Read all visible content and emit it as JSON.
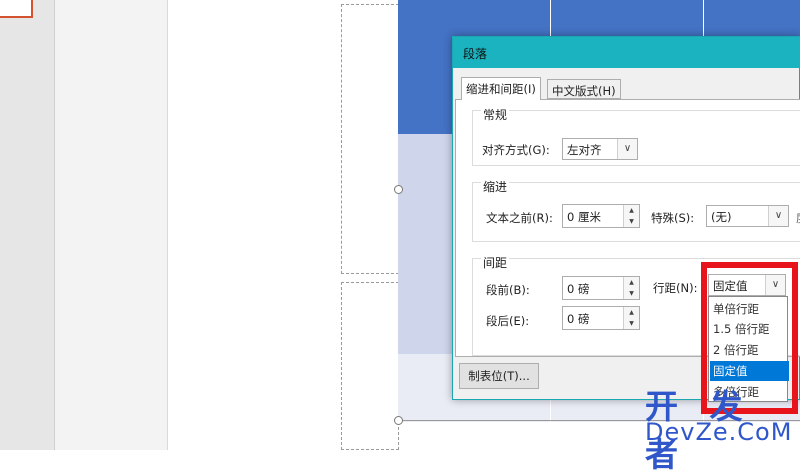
{
  "dialog": {
    "title": "段落",
    "tabs": [
      {
        "label": "缩进和间距(I)",
        "active": true
      },
      {
        "label": "中文版式(H)",
        "active": false
      }
    ],
    "general": {
      "heading": "常规",
      "alignment_label": "对齐方式(G):",
      "alignment_value": "左对齐"
    },
    "indent": {
      "heading": "缩进",
      "before_text_label": "文本之前(R):",
      "before_text_value": "0 厘米",
      "special_label": "特殊(S):",
      "special_value": "(无)",
      "cut_off_char": "度"
    },
    "spacing": {
      "heading": "间距",
      "before_label": "段前(B):",
      "before_value": "0 磅",
      "after_label": "段后(E):",
      "after_value": "0 磅",
      "line_spacing_label": "行距(N):",
      "line_spacing_value": "固定值",
      "line_spacing_options": [
        {
          "label": "单倍行距",
          "selected": false
        },
        {
          "label": "1.5 倍行距",
          "selected": false
        },
        {
          "label": "2 倍行距",
          "selected": false
        },
        {
          "label": "固定值",
          "selected": true
        },
        {
          "label": "多倍行距",
          "selected": false
        }
      ]
    },
    "tabs_button_label": "制表位(T)..."
  },
  "watermark": {
    "top": "开 发 者",
    "bottom": "DevZe.CoM"
  },
  "colors": {
    "title_bar": "#1ab3bf",
    "table_header": "#4472c4",
    "table_band": "#cfd5ea",
    "highlight": "#e8141c",
    "selection": "#0078d7",
    "watermark": "#2f57c9"
  }
}
